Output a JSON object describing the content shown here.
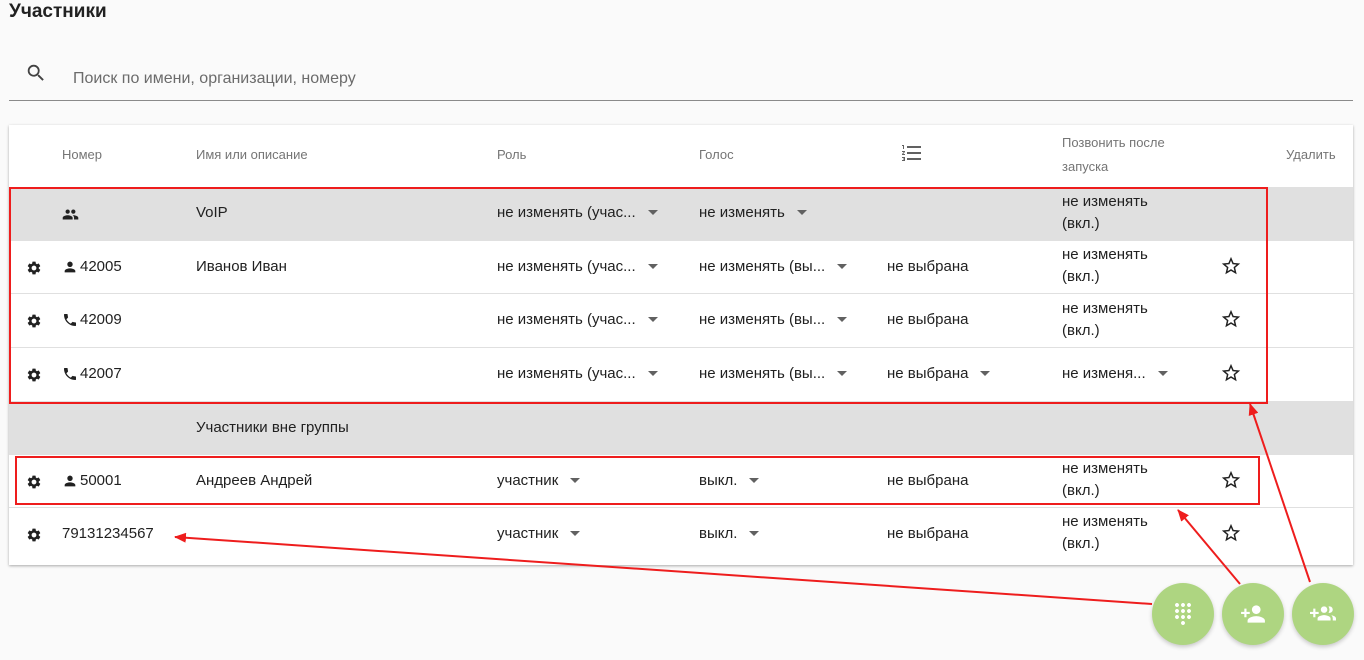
{
  "page": {
    "title": "Участники"
  },
  "search": {
    "placeholder": "Поиск по имени, организации, номеру"
  },
  "table": {
    "headers": {
      "number": "Номер",
      "name": "Имя или описание",
      "role": "Роль",
      "voice": "Голос",
      "call_after_start": "Позвонить после запуска",
      "delete": "Удалить"
    },
    "group_row": {
      "name": "VoIP",
      "role": "не изменять (учас...",
      "voice": "не изменять",
      "call": "не изменять (вкл.)"
    },
    "group_members": [
      {
        "number": "42005",
        "type": "person",
        "name": "Иванов Иван",
        "role": "не изменять (учас...",
        "voice": "не изменять (вы...",
        "list": "не выбрана",
        "call": "не изменять (вкл.)"
      },
      {
        "number": "42009",
        "type": "phone",
        "name": "",
        "role": "не изменять (учас...",
        "voice": "не изменять (вы...",
        "list": "не выбрана",
        "call": "не изменять (вкл.)"
      },
      {
        "number": "42007",
        "type": "phone",
        "name": "",
        "role": "не изменять (учас...",
        "voice": "не изменять (вы...",
        "list": "не выбрана",
        "call": "не изменя..."
      }
    ],
    "ungrouped_header": "Участники вне группы",
    "ungrouped": [
      {
        "number": "50001",
        "type": "person",
        "name": "Андреев Андрей",
        "role": "участник",
        "voice": "выкл.",
        "list": "не выбрана",
        "call": "не изменять (вкл.)"
      },
      {
        "number": "79131234567",
        "type": "none",
        "name": "",
        "role": "участник",
        "voice": "выкл.",
        "list": "не выбрана",
        "call": "не изменять (вкл.)"
      }
    ]
  },
  "fabs": {
    "dialpad": "dialpad-icon",
    "add_person": "person-add-icon",
    "add_group": "group-add-icon"
  },
  "colors": {
    "fab": "#aed581",
    "annotation": "#ee1d1d",
    "group_row": "#e0e0e0"
  }
}
